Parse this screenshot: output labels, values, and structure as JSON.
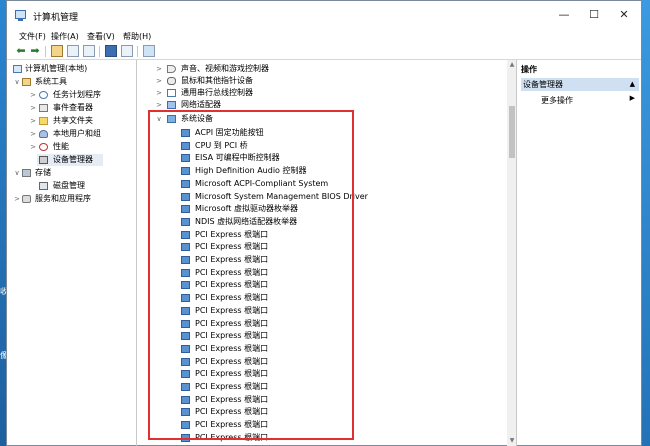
{
  "desktop": {
    "left_fragments": [
      "收",
      "像"
    ]
  },
  "window": {
    "title": "计算机管理",
    "controls": {
      "minimize": "—",
      "maximize": "☐",
      "close": "✕"
    }
  },
  "menu": [
    "文件(F)",
    "操作(A)",
    "查看(V)",
    "帮助(H)"
  ],
  "left_tree": [
    {
      "label": "计算机管理(本地)",
      "icon": "computer-icon",
      "chevron": "",
      "level": 0
    },
    {
      "label": "系统工具",
      "icon": "tools-icon",
      "chevron": "∨",
      "level": 1
    },
    {
      "label": "任务计划程序",
      "icon": "task-scheduler-icon",
      "chevron": ">",
      "level": 2
    },
    {
      "label": "事件查看器",
      "icon": "event-viewer-icon",
      "chevron": ">",
      "level": 2
    },
    {
      "label": "共享文件夹",
      "icon": "shared-folder-icon",
      "chevron": ">",
      "level": 2
    },
    {
      "label": "本地用户和组",
      "icon": "users-icon",
      "chevron": ">",
      "level": 2
    },
    {
      "label": "性能",
      "icon": "performance-icon",
      "chevron": ">",
      "level": 2
    },
    {
      "label": "设备管理器",
      "icon": "device-manager-icon",
      "chevron": "",
      "level": 2
    },
    {
      "label": "存储",
      "icon": "storage-icon",
      "chevron": "∨",
      "level": 1
    },
    {
      "label": "磁盘管理",
      "icon": "disk-management-icon",
      "chevron": "",
      "level": 2
    },
    {
      "label": "服务和应用程序",
      "icon": "services-icon",
      "chevron": ">",
      "level": 1
    }
  ],
  "device_tree": {
    "collapsed_categories": [
      {
        "label": "声音、视频和游戏控制器",
        "icon": "sound-icon"
      },
      {
        "label": "鼠标和其他指针设备",
        "icon": "mouse-icon"
      },
      {
        "label": "通用串行总线控制器",
        "icon": "usb-icon"
      },
      {
        "label": "网络适配器",
        "icon": "network-adapter-icon"
      }
    ],
    "expanded_category": "系统设备",
    "system_devices": [
      "ACPI 固定功能按钮",
      "CPU 到 PCI 桥",
      "EISA 可编程中断控制器",
      "High Definition Audio 控制器",
      "Microsoft ACPI-Compliant System",
      "Microsoft System Management BIOS Driver",
      "Microsoft 虚拟驱动器枚举器",
      "NDIS 虚拟网络适配器枚举器",
      "PCI Express 根端口",
      "PCI Express 根端口",
      "PCI Express 根端口",
      "PCI Express 根端口",
      "PCI Express 根端口",
      "PCI Express 根端口",
      "PCI Express 根端口",
      "PCI Express 根端口",
      "PCI Express 根端口",
      "PCI Express 根端口",
      "PCI Express 根端口",
      "PCI Express 根端口",
      "PCI Express 根端口",
      "PCI Express 根端口",
      "PCI Express 根端口",
      "PCI Express 根端口",
      "PCI Express 根端口"
    ]
  },
  "actions_pane": {
    "header": "操作",
    "section": "设备管理器",
    "section_arrow": "▲",
    "more": "更多操作",
    "more_arrow": "▶"
  },
  "colors": {
    "highlight": "#e0302f",
    "section": "#cfe0f2"
  }
}
